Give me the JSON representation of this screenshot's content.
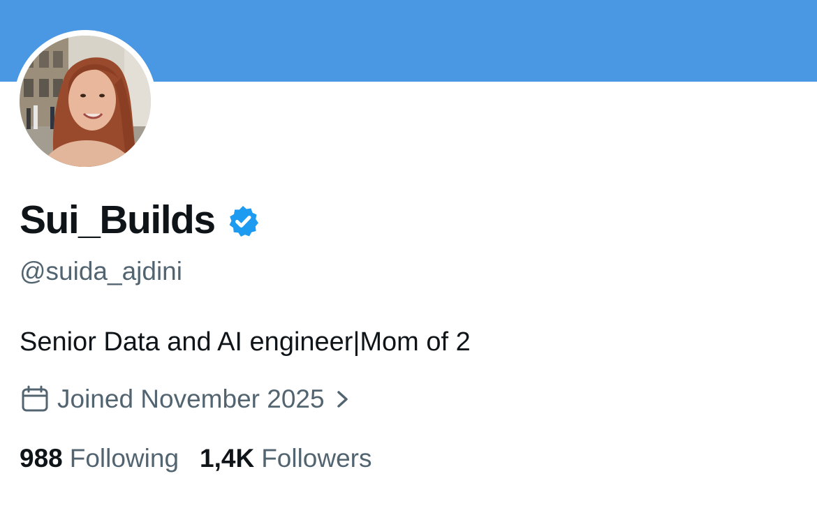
{
  "colors": {
    "banner": "#4a98e3",
    "verified_badge": "#1d9bf0",
    "primary_text": "#0f1419",
    "secondary_text": "#536471"
  },
  "profile": {
    "display_name": "Sui_Builds",
    "verified": true,
    "handle": "@suida_ajdini",
    "bio": "Senior Data and AI engineer|Mom of 2",
    "joined": "Joined November 2025",
    "following_count": "988",
    "following_label": "Following",
    "followers_count": "1,4K",
    "followers_label": "Followers"
  },
  "icons": {
    "verified": "verified-badge-icon",
    "joined": "calendar-icon",
    "joined_more": "chevron-right-icon"
  }
}
